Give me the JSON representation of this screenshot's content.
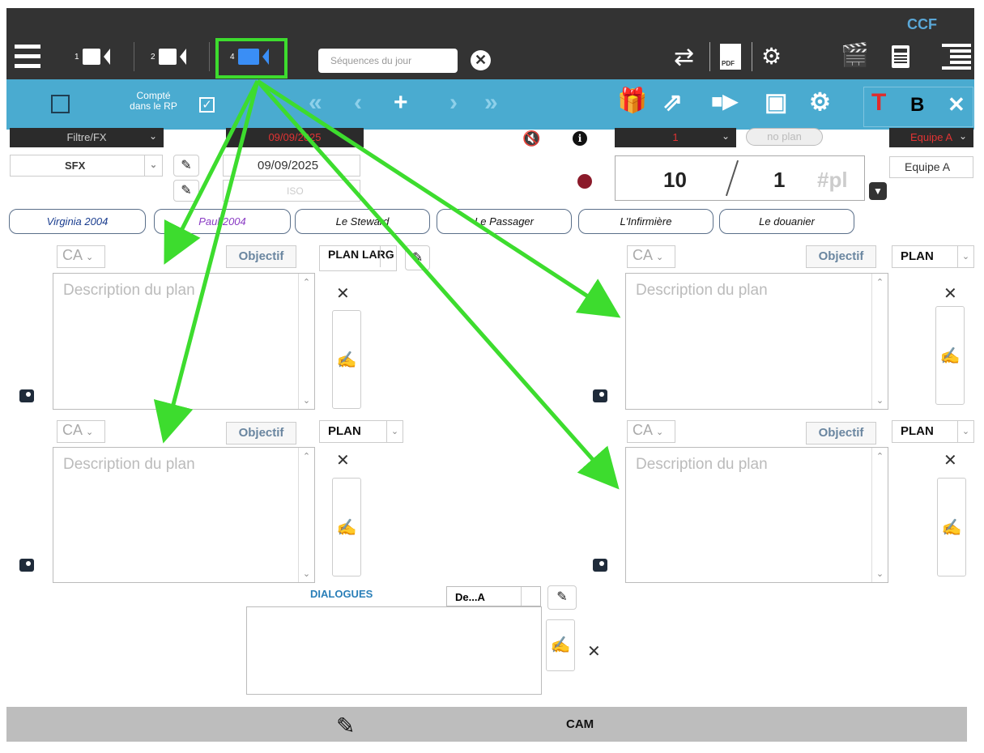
{
  "topbar": {
    "cam1_label": "1",
    "cam2_label": "2",
    "cam4_label": "4",
    "search_placeholder": "Séquences du jour",
    "brand": "CCF",
    "icons": [
      "menu-icon",
      "camera-icon",
      "swap-icon",
      "pdf-icon",
      "user-settings-icon",
      "clapperboard-icon",
      "calculator-icon",
      "list-icon"
    ]
  },
  "toolbar": {
    "compte_label": "Compté\ndans le RP",
    "t_label": "T",
    "b_label": "B"
  },
  "filters": {
    "filtre_label": "Filtre/FX",
    "date_dark": "09/09/2025",
    "sfx_label": "SFX",
    "date_value": "09/09/2025",
    "iso_label": "ISO",
    "plan_number_dark": "1",
    "no_plan_label": "no plan",
    "equipe_dark": "Equipe A",
    "equipe_value": "Equipe A"
  },
  "counter": {
    "sequence": "10",
    "plan": "1",
    "pl_placeholder": "#pl"
  },
  "characters": [
    "Virginia 2004",
    "Paul 2004",
    "Le Steward",
    "Le Passager",
    "L'Infirmière",
    "Le douanier"
  ],
  "character_colors": [
    "#1a3d8f",
    "#8a3bc4",
    "#111111",
    "#111111",
    "#111111",
    "#111111"
  ],
  "plans": {
    "ca_label": "CA",
    "objectif_label": "Objectif",
    "plan_label": "PLAN",
    "plan_label_truncated": "PLAN LARG",
    "description_placeholder": "Description du plan"
  },
  "dialogues": {
    "title": "DIALOGUES",
    "select_value": "De...A"
  },
  "bottom": {
    "cam_label": "CAM"
  },
  "colors": {
    "topbar": "#333333",
    "toolbar": "#4aabd0",
    "highlight": "#3ddc2e",
    "active_camera": "#3a8ef5",
    "bottombar": "#bdbdbd"
  }
}
